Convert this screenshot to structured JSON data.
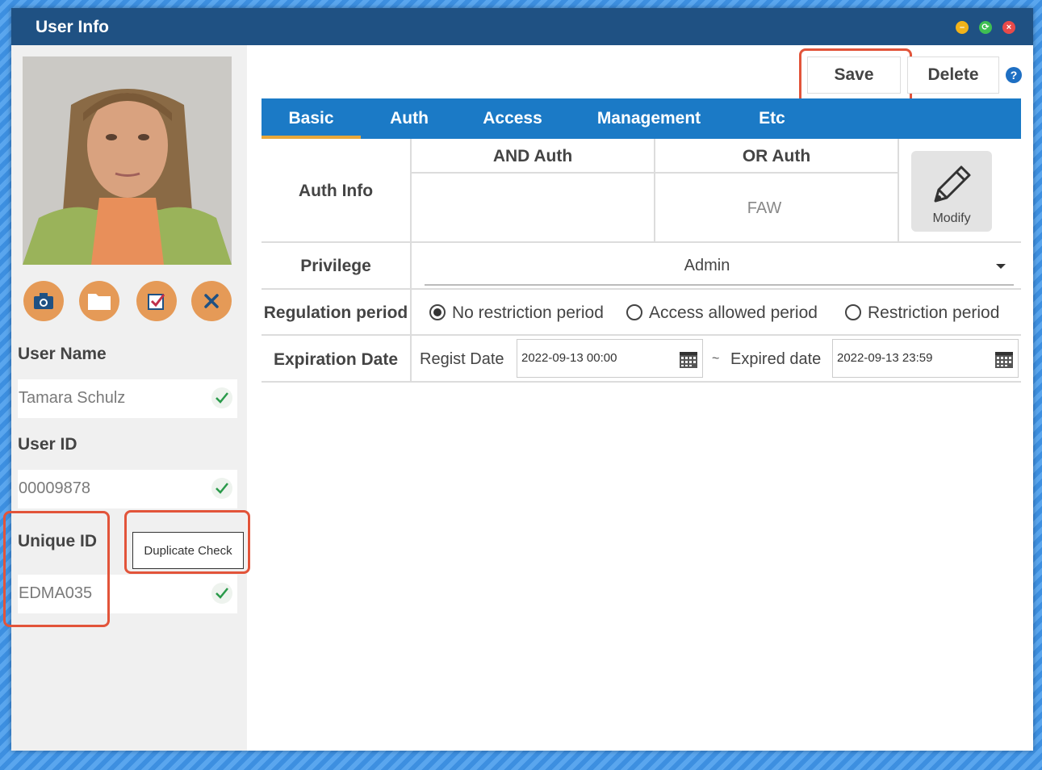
{
  "window": {
    "title": "User Info"
  },
  "left": {
    "user_name_label": "User Name",
    "user_name_value": "Tamara Schulz",
    "user_id_label": "User ID",
    "user_id_value": "00009878",
    "unique_id_label": "Unique ID",
    "unique_id_value": "EDMA035",
    "duplicate_check": "Duplicate Check",
    "action_icons": [
      "camera-icon",
      "folder-icon",
      "checkbox-icon",
      "close-icon"
    ]
  },
  "toolbar": {
    "save": "Save",
    "delete": "Delete",
    "help": "?"
  },
  "tabs": [
    "Basic",
    "Auth",
    "Access",
    "Management",
    "Etc"
  ],
  "basic": {
    "auth_info_label": "Auth Info",
    "and_auth_header": "AND Auth",
    "or_auth_header": "OR Auth",
    "and_auth_value": "",
    "or_auth_value": "FAW",
    "modify": "Modify",
    "privilege_label": "Privilege",
    "privilege_value": "Admin",
    "regulation_label": "Regulation period",
    "regulation_options": [
      "No restriction period",
      "Access allowed period",
      "Restriction period"
    ],
    "regulation_selected": "No restriction period",
    "expiration_label": "Expiration Date",
    "regist_label": "Regist Date",
    "regist_value": "2022-09-13 00:00",
    "tilde": "~",
    "expired_label": "Expired date",
    "expired_value": "2022-09-13 23:59"
  },
  "colors": {
    "titlebar": "#1f5183",
    "tabbar": "#1b7ac6",
    "accent": "#e8a73a",
    "highlight": "#e2543a",
    "action_button": "#e59a57"
  }
}
